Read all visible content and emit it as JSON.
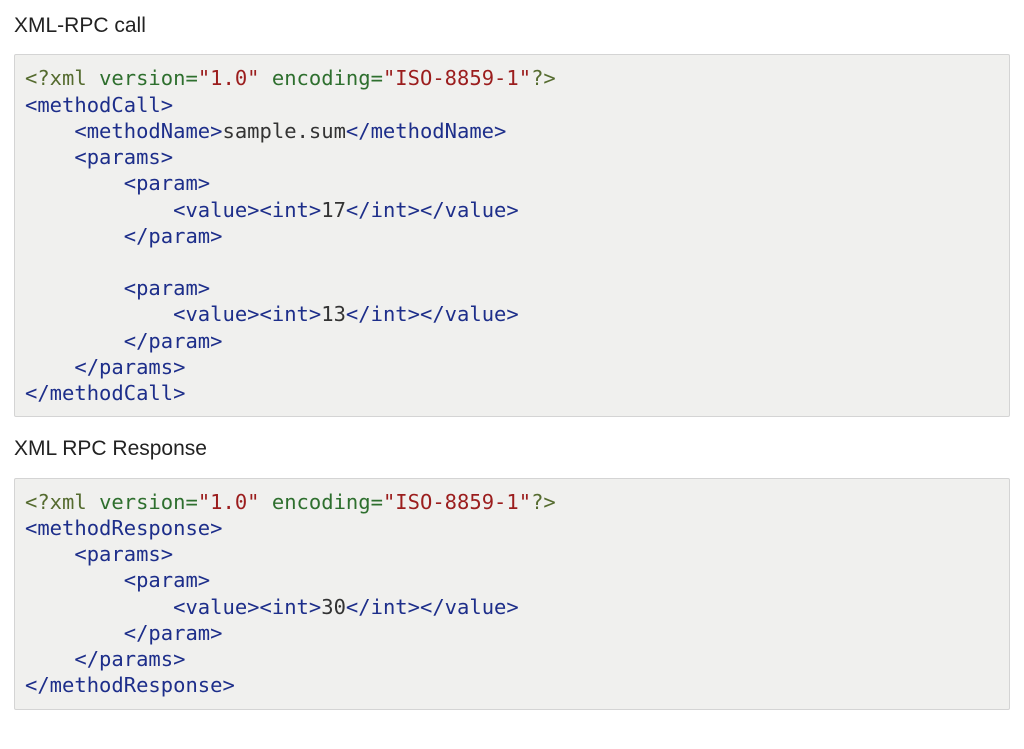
{
  "headings": {
    "call": "XML-RPC call",
    "response": "XML RPC Response"
  },
  "xml": {
    "decl_open": "<?xml ",
    "decl_attrs_version_key": "version=",
    "decl_attrs_version_val": "\"1.0\"",
    "decl_attrs_encoding_key": " encoding=",
    "decl_attrs_encoding_val": "\"ISO-8859-1\"",
    "decl_close": "?>"
  },
  "call": {
    "root_open": "<methodCall>",
    "root_close": "</methodCall>",
    "methodName_open": "    <methodName>",
    "methodName_text": "sample.sum",
    "methodName_close": "</methodName>",
    "params_open": "    <params>",
    "params_close": "    </params>",
    "param_open": "        <param>",
    "param_close": "        </param>",
    "value_indent": "            ",
    "value_open": "<value>",
    "value_close": "</value>",
    "int_open": "<int>",
    "int_close": "</int>",
    "val1": "17",
    "val2": "13"
  },
  "resp": {
    "root_open": "<methodResponse>",
    "root_close": "</methodResponse>",
    "params_open": "    <params>",
    "params_close": "    </params>",
    "param_open": "        <param>",
    "param_close": "        </param>",
    "value_indent": "            ",
    "value_open": "<value>",
    "value_close": "</value>",
    "int_open": "<int>",
    "int_close": "</int>",
    "val": "30"
  }
}
